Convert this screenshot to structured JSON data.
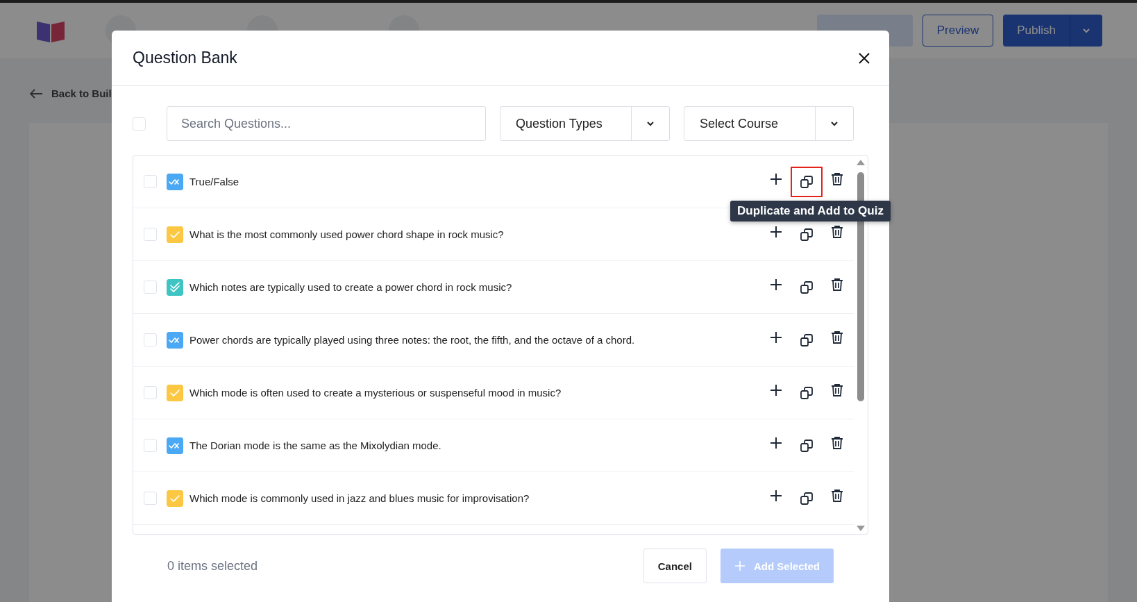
{
  "app_header": {
    "preview_button": "Preview",
    "publish_button": "Publish"
  },
  "back_link": "Back to Buil",
  "dialog": {
    "title": "Question Bank",
    "filters": {
      "select_all_checked": false,
      "search_placeholder": "Search Questions...",
      "question_types": "Question Types",
      "course": "Select Course"
    },
    "questions": [
      {
        "kind": "true_false",
        "text": "True/False",
        "checked": false,
        "highlighted": true
      },
      {
        "kind": "single",
        "text": "What is the most commonly used power chord shape in rock music?",
        "checked": false,
        "highlighted": false
      },
      {
        "kind": "multiple",
        "text": "Which notes are typically used to create a power chord in rock music?",
        "checked": false,
        "highlighted": false
      },
      {
        "kind": "true_false",
        "text": "Power chords are typically played using three notes: the root, the fifth, and the octave of a chord.",
        "checked": false,
        "highlighted": false
      },
      {
        "kind": "single",
        "text": "Which mode is often used to create a mysterious or suspenseful mood in music?",
        "checked": false,
        "highlighted": false
      },
      {
        "kind": "true_false",
        "text": "The Dorian mode is the same as the Mixolydian mode.",
        "checked": false,
        "highlighted": false
      },
      {
        "kind": "single",
        "text": "Which mode is commonly used in jazz and blues music for improvisation?",
        "checked": false,
        "highlighted": false
      }
    ],
    "tooltip": "Duplicate and Add to Quiz",
    "selection_count": "0 items selected",
    "cancel_button": "Cancel",
    "add_button": {
      "label": "Add Selected",
      "disabled": true
    }
  }
}
